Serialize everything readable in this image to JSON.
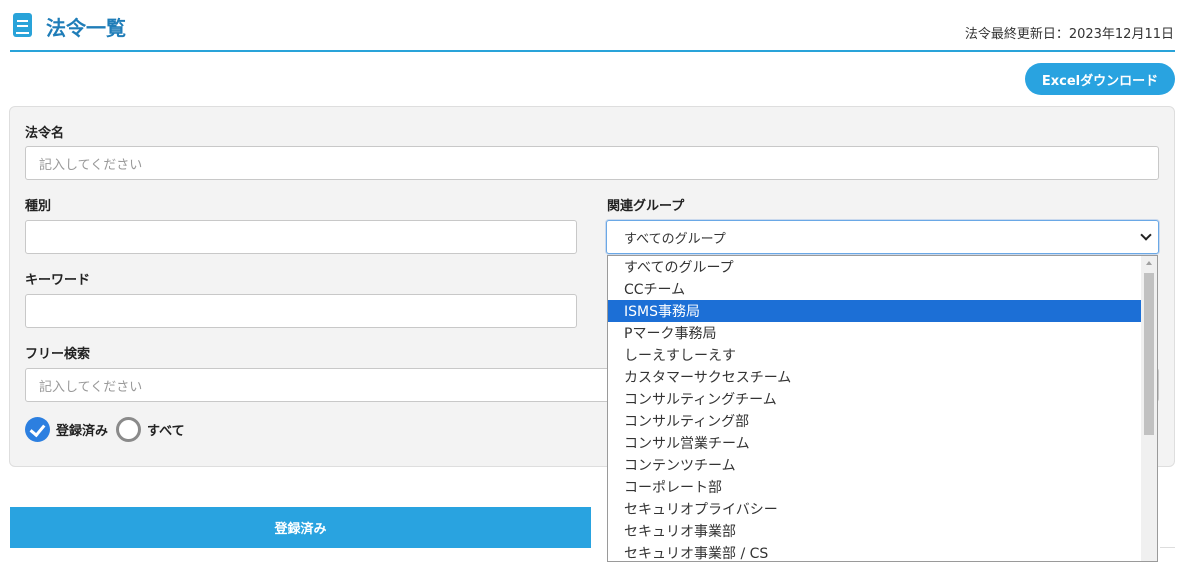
{
  "header": {
    "title": "法令一覧",
    "updated": "法令最終更新日：2023年12月11日"
  },
  "toolbar": {
    "excel_label": "Excelダウンロード"
  },
  "form": {
    "law_name_label": "法令名",
    "law_name_placeholder": "記入してください",
    "type_label": "種別",
    "type_value": "",
    "group_label": "関連グループ",
    "group_value": "すべてのグループ",
    "keyword_label": "キーワード",
    "keyword_value": "",
    "free_search_label": "フリー検索",
    "free_search_placeholder": "記入してください",
    "radio_registered": "登録済み",
    "radio_all": "すべて"
  },
  "tabs": {
    "registered": "登録済み"
  },
  "dropdown": {
    "options": [
      "すべてのグループ",
      "CCチーム",
      "ISMS事務局",
      "Pマーク事務局",
      "しーえすしーえす",
      "カスタマーサクセスチーム",
      "コンサルティングチーム",
      "コンサルティング部",
      "コンサル営業チーム",
      "コンテンツチーム",
      "コーポレート部",
      "セキュリオプライバシー",
      "セキュリオ事業部",
      "セキュリオ事業部 / CS"
    ],
    "selected_index": 2
  },
  "colors": {
    "accent": "#29a3e0",
    "title": "#1f7db8",
    "selection": "#1c6fd6"
  }
}
